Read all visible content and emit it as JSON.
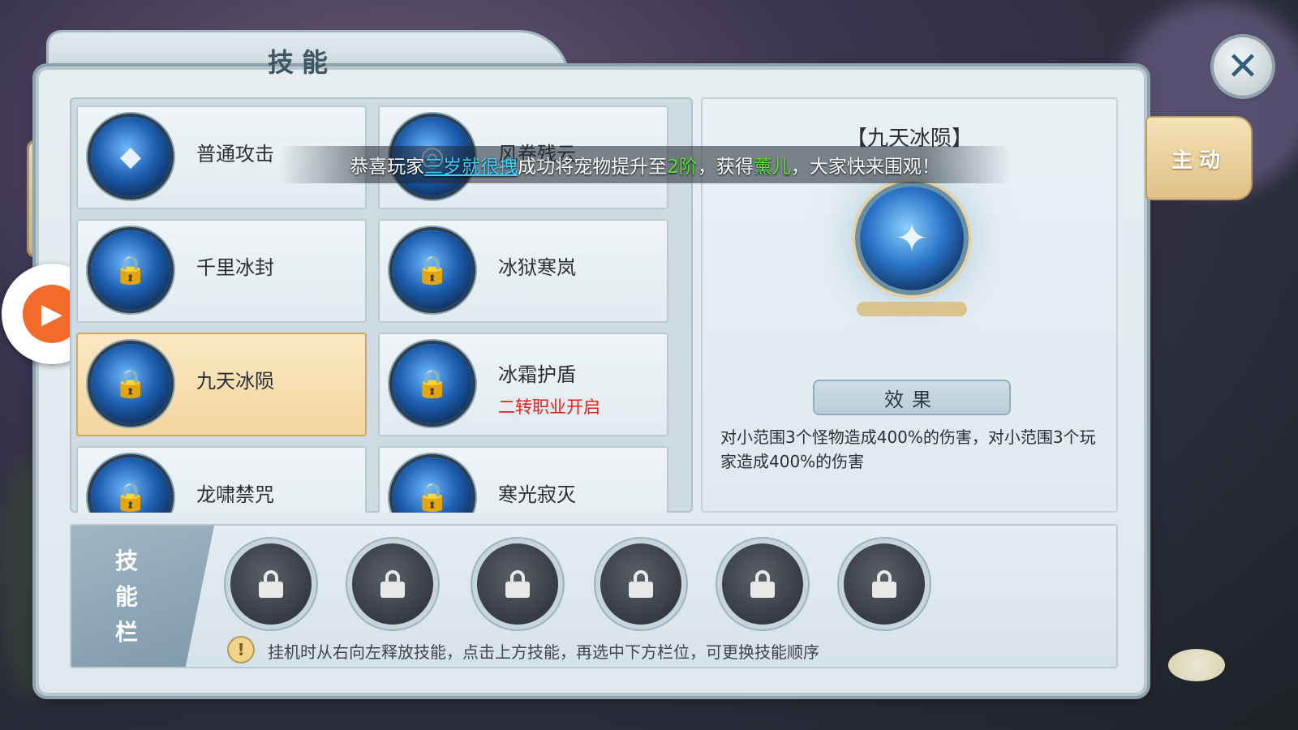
{
  "window": {
    "title": "技能",
    "close_icon": "close-icon"
  },
  "side_tab": {
    "label": "主动"
  },
  "announcement": {
    "prefix": "恭喜玩家",
    "player": "三岁就很拽",
    "middle": "成功将宠物提升至",
    "level": "2阶",
    "sep": "，获得",
    "pet": "薰儿",
    "suffix": "，大家快来围观！"
  },
  "skills": [
    {
      "name": "普通攻击",
      "requirement": "",
      "locked": false,
      "selected": false,
      "icon": "crystal-icon"
    },
    {
      "name": "风卷残云",
      "requirement": "",
      "locked": false,
      "selected": false,
      "icon": "whirlwind-icon"
    },
    {
      "name": "千里冰封",
      "requirement": "",
      "locked": true,
      "selected": false,
      "icon": "lock-icon"
    },
    {
      "name": "冰狱寒岚",
      "requirement": "",
      "locked": true,
      "selected": false,
      "icon": "lock-icon"
    },
    {
      "name": "九天冰陨",
      "requirement": "",
      "locked": true,
      "selected": true,
      "icon": "lock-icon"
    },
    {
      "name": "冰霜护盾",
      "requirement": "二转职业开启",
      "locked": true,
      "selected": false,
      "icon": "lock-icon"
    },
    {
      "name": "龙啸禁咒",
      "requirement": "",
      "locked": true,
      "selected": false,
      "icon": "lock-icon"
    },
    {
      "name": "寒光寂灭",
      "requirement": "",
      "locked": true,
      "selected": false,
      "icon": "lock-icon"
    }
  ],
  "detail": {
    "title": "【九天冰陨】",
    "effect_label": "效果",
    "effect_text": "对小范围3个怪物造成400%的伤害，对小范围3个玩家造成400%的伤害"
  },
  "skill_bar": {
    "label_chars": [
      "技",
      "能",
      "栏"
    ],
    "slots": [
      "locked",
      "locked",
      "locked",
      "locked",
      "locked",
      "locked"
    ],
    "tip": "挂机时从右向左释放技能，点击上方技能，再选中下方栏位，可更换技能顺序"
  },
  "colors": {
    "selected_card": "#f3d6a0",
    "requirement_red": "#e3211c",
    "player_link": "#3fd0ff",
    "highlight_green": "#5de03a"
  }
}
